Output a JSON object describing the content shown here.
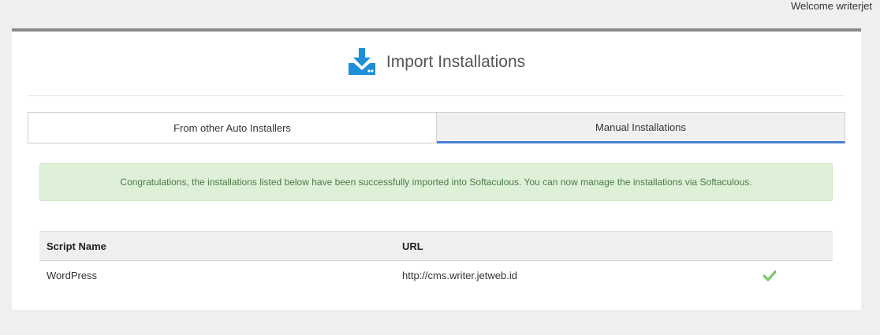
{
  "header": {
    "welcome": "Welcome writerjet"
  },
  "page": {
    "title": "Import Installations",
    "icon": "download-import-icon",
    "accent_color": "#1e8fd6"
  },
  "tabs": [
    {
      "label": "From other Auto Installers",
      "active": false
    },
    {
      "label": "Manual Installations",
      "active": true
    }
  ],
  "alert": {
    "message": "Congratulations, the installations listed below have been successfully imported into Softaculous. You can now manage the installations via Softaculous.",
    "type": "success"
  },
  "table": {
    "columns": [
      "Script Name",
      "URL",
      ""
    ],
    "rows": [
      {
        "script": "WordPress",
        "url": "http://cms.writer.jetweb.id",
        "status_icon": "check-icon",
        "status_color": "#5cb85c"
      }
    ]
  }
}
